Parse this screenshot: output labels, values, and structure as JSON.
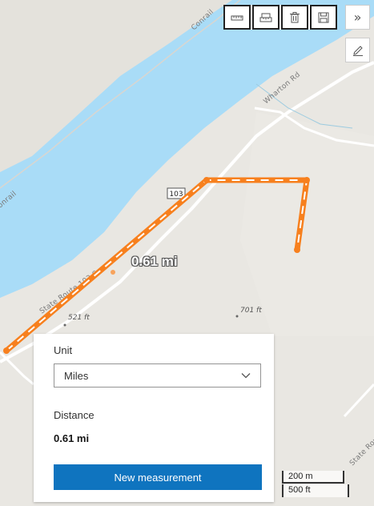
{
  "toolbar": {
    "buttons": [
      {
        "name": "distance-measurement-button",
        "icon": "measure-line-icon"
      },
      {
        "name": "area-measurement-button",
        "icon": "measure-area-icon"
      },
      {
        "name": "clear-button",
        "icon": "trash-icon"
      },
      {
        "name": "save-button",
        "icon": "floppy-disk-icon"
      }
    ],
    "expand_label": "»",
    "edit_icon": "pencil-icon"
  },
  "map": {
    "road_labels": [
      "Conrail",
      "Wharton Rd",
      "onrail",
      "State Route 103 S",
      "State Route"
    ],
    "route_shield": "103",
    "peaks": [
      "521 ft",
      "701 ft"
    ],
    "measurement_label": "0.61 mi",
    "colors": {
      "water": "#a9dcf7",
      "land": "#e9e7e2",
      "measure_line": "#f7801e"
    }
  },
  "panel": {
    "unit_label": "Unit",
    "unit_value": "Miles",
    "distance_label": "Distance",
    "distance_value": "0.61 mi",
    "new_measurement_label": "New measurement"
  },
  "scale": {
    "metric": "200 m",
    "imperial": "500 ft"
  }
}
